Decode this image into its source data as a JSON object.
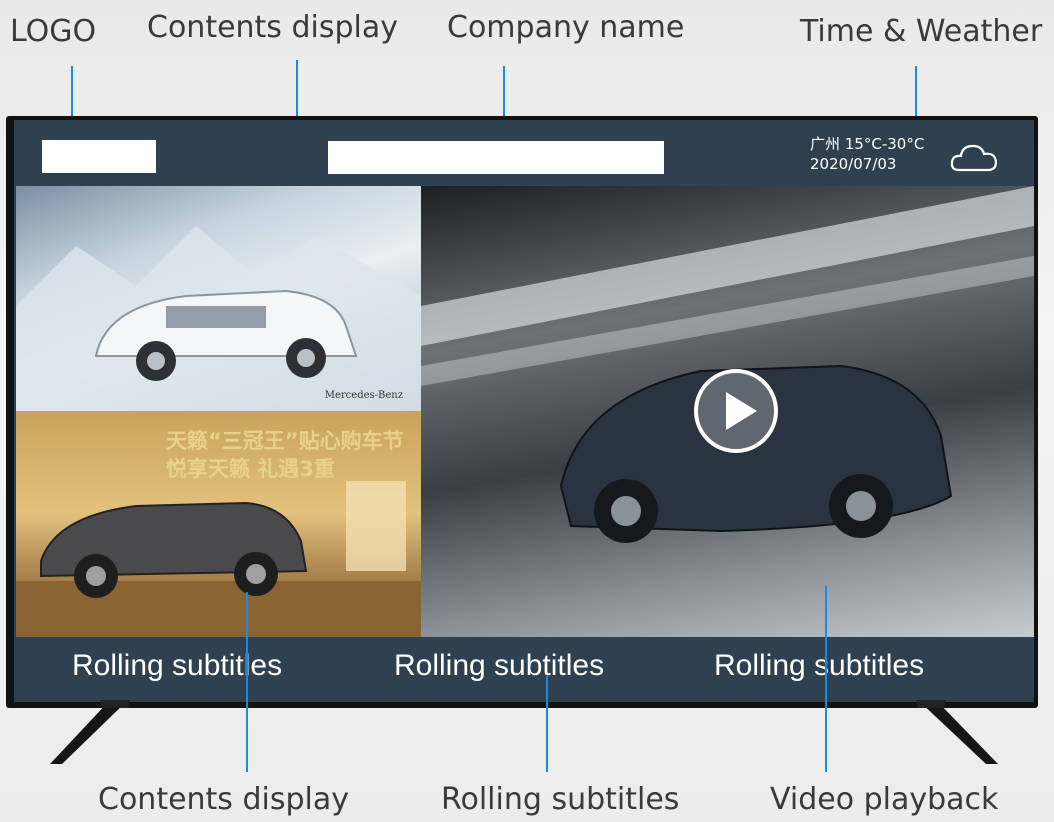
{
  "callouts": {
    "top": [
      "LOGO",
      "Contents display",
      "Company name",
      "Time & Weather"
    ],
    "bottom": [
      "Contents display",
      "Rolling subtitles",
      "Video playback"
    ]
  },
  "screen": {
    "weather": {
      "city_temp": "广州 15°C-30°C",
      "date": "2020/07/03",
      "icon": "cloud-icon"
    },
    "ads": {
      "tile1_brand": "Mercedes-Benz",
      "tile2_line1": "天籁“三冠王”贴心购车节",
      "tile2_line2": "悦享天籁 礼遇3重"
    },
    "video": {
      "icon": "play-icon"
    },
    "subtitles": [
      "Rolling subtitles",
      "Rolling subtitles",
      "Rolling subtitles"
    ]
  },
  "colors": {
    "screen_header": "#2f4150",
    "callout_line": "#1a8be0",
    "callout_text": "#3a3a3a",
    "placeholder": "#ffffff"
  }
}
